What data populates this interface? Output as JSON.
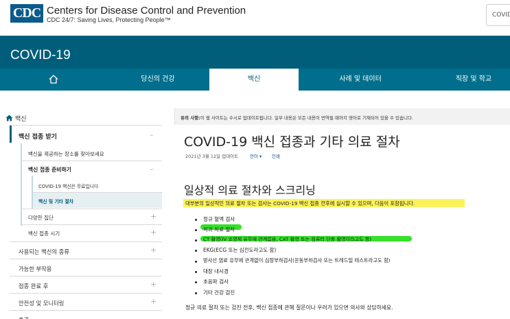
{
  "header": {
    "logo_text": "CDC",
    "org_name": "Centers for Disease Control and Prevention",
    "tagline": "CDC 24/7: Saving Lives, Protecting People™",
    "search_placeholder": "COVID"
  },
  "banner": {
    "title": "COVID-19"
  },
  "nav": {
    "items": [
      {
        "label": "",
        "icon": "home-icon"
      },
      {
        "label": "당신의 건강"
      },
      {
        "label": "백신"
      },
      {
        "label": "사례 및 데이터"
      },
      {
        "label": "직장 및 학교"
      }
    ],
    "active_index": 2
  },
  "sidebar": {
    "breadcrumb": "백신",
    "items": [
      {
        "label": "백신 접종 받기",
        "icon": "–"
      },
      {
        "label": "백신을 제공하는 장소를 찾아보세요"
      },
      {
        "label": "백신 접종 준비하기",
        "icon": "–"
      },
      {
        "label": "COVID-19 백신은 무료입니다"
      },
      {
        "label": "백신 및 기타 절차"
      },
      {
        "label": "다양한 집단",
        "icon": "+"
      },
      {
        "label": "백신 접종 시기",
        "icon": "+"
      },
      {
        "label": "사용되는 백신의 종류",
        "icon": "+"
      },
      {
        "label": "가능한 부작용"
      },
      {
        "label": "접종 완료 후",
        "icon": "+"
      },
      {
        "label": "안전성 및 모니터링",
        "icon": "+"
      },
      {
        "label": "효과"
      }
    ]
  },
  "main": {
    "notice_bold": "유의 사항:",
    "notice_text": "이 웹 사이트는 수시로 업데이트됩니다. 일부 내용은 모든 내용이 번역될 때까지 영어로 기재되어 있을 수 있습니다.",
    "title": "COVID-19 백신 접종과 기타 의료 절차",
    "updated": "2021년 3월 12일 업데이트",
    "language": "언어 ▾",
    "print": "인쇄",
    "section_title": "일상적 의료 절차와 스크리닝",
    "intro": "대부분의 일상적인 의료 절차 또는 검사는 COVID-19 백신 접종 전후에 실시할 수 있으며, 다음이 포함됩니다.",
    "list": [
      "정규 혈액 검사",
      "치과 치료 절차",
      "CT 촬영(IV 조영제 유무에 관계없음, CAT 촬영 또는 컴퓨터 단층 촬영이라고도 함)",
      "EKG(ECG 또는 심전도라고도 함)",
      "방사선 염료 유무에 관계없이 심장부하검사(운동부하검사 또는 트레드밀 테스트라고도 함)",
      "대장 내시경",
      "초음파 검사",
      "기타 건강 검진"
    ],
    "footer": "정규 의료 절차 또는 검진 전후, 백신 접종에 관해 질문이나 우려가 있으면 의사와 상담하세요."
  },
  "colors": {
    "brand_teal": "#005e7a",
    "nav_teal": "#006e8c",
    "highlight_yellow": "#fbf25a",
    "highlight_green": "#37e02a",
    "link_blue": "#075290"
  }
}
